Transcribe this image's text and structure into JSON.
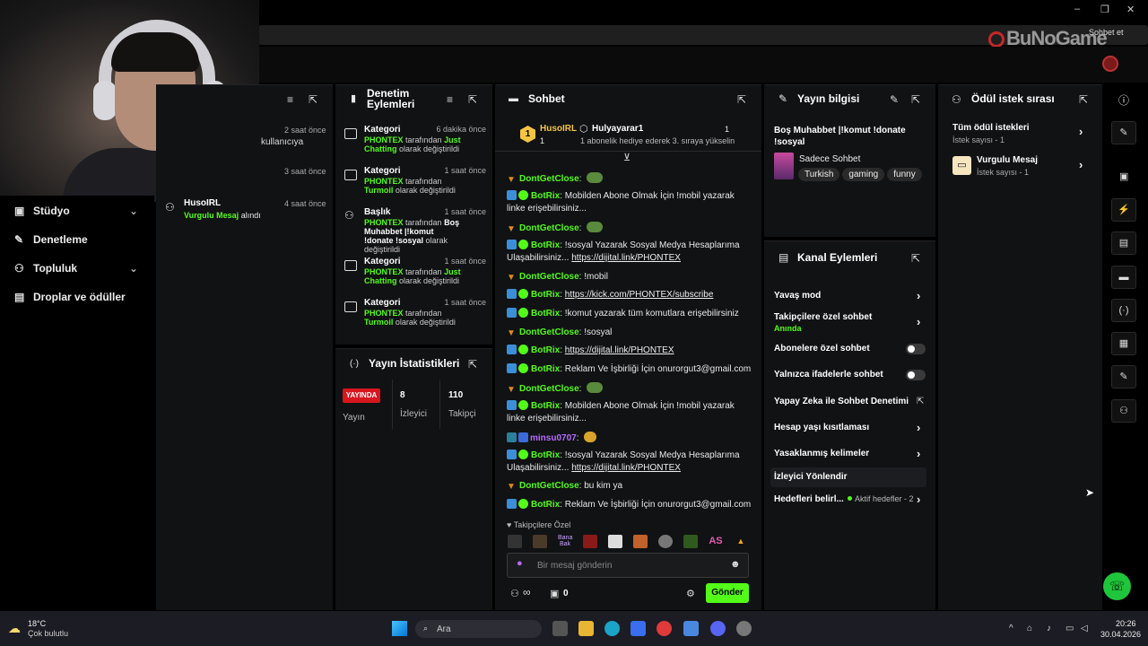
{
  "browser": {
    "tab_label": "Sohbet et",
    "logo_text": "BuNoGame",
    "win_controls": [
      "–",
      "❐",
      "✕"
    ]
  },
  "nav": {
    "studio": "Stüdyo",
    "moderation": "Denetleme",
    "community": "Topluluk",
    "drops": "Droplar ve ödüller"
  },
  "activity": {
    "rows": [
      {
        "user": "",
        "action": "kullanıcıya",
        "time": "2 saat önce"
      },
      {
        "user": "",
        "action": "",
        "time": "3 saat önce"
      },
      {
        "user": "HusoIRL",
        "highlight": "Vurgulu Mesaj",
        "action": "alındı",
        "time": "4 saat önce"
      }
    ]
  },
  "mod_actions": {
    "title_line1": "Denetim",
    "title_line2": "Eylemleri",
    "items": [
      {
        "type": "Kategori",
        "time": "6 dakika önce",
        "actor": "PHONTEX",
        "mid": "tarafından",
        "value": "Just Chatting",
        "suffix": "olarak değiştirildi"
      },
      {
        "type": "Kategori",
        "time": "1 saat önce",
        "actor": "PHONTEX",
        "mid": "tarafından",
        "value": "Turmoil",
        "suffix": "olarak değiştirildi"
      },
      {
        "type": "Başlık",
        "time": "1 saat önce",
        "actor": "PHONTEX",
        "mid": "tarafından",
        "value": "Boş Muhabbet |!komut !donate !sosyal",
        "suffix": "olarak değiştirildi"
      },
      {
        "type": "Kategori",
        "time": "1 saat önce",
        "actor": "PHONTEX",
        "mid": "tarafından",
        "value": "Just Chatting",
        "suffix": "olarak değiştirildi"
      },
      {
        "type": "Kategori",
        "time": "1 saat önce",
        "actor": "PHONTEX",
        "mid": "tarafından",
        "value": "Turmoil",
        "suffix": "olarak değiştirildi"
      }
    ]
  },
  "stats": {
    "title": "Yayın İstatistikleri",
    "live_badge": "YAYINDA",
    "live_label": "Yayın",
    "viewers_value": "8",
    "viewers_label": "İzleyici",
    "followers_value": "110",
    "followers_label": "Takipçi"
  },
  "chat": {
    "title": "Sohbet",
    "pinned_user": "HusoIRL",
    "pinned_rank": "1",
    "pinned_count": "1",
    "gift_user": "Hulyayarar1",
    "gift_count": "1",
    "gift_text": "1 abonelik hediye ederek 3. sıraya yükselin",
    "messages": [
      {
        "user": "DontGetClose",
        "text": "",
        "kind": "frog"
      },
      {
        "user": "BotRix",
        "text": "Mobilden Abone Olmak İçin !mobil yazarak linke erişebilirsiniz...",
        "kind": "bot"
      },
      {
        "user": "DontGetClose",
        "text": "",
        "kind": "frog"
      },
      {
        "user": "BotRix",
        "text": "!sosyal Yazarak Sosyal Medya Hesaplarıma Ulaşabilirsiniz...",
        "link": "https://dijital.link/PHONTEX",
        "kind": "bot"
      },
      {
        "user": "DontGetClose",
        "text": "!mobil",
        "kind": "user"
      },
      {
        "user": "BotRix",
        "link": "https://kick.com/PHONTEX/subscribe",
        "kind": "bot"
      },
      {
        "user": "BotRix",
        "text": "!komut yazarak tüm komutlara erişebilirsiniz",
        "kind": "bot"
      },
      {
        "user": "DontGetClose",
        "text": "!sosyal",
        "kind": "user"
      },
      {
        "user": "BotRix",
        "link": "https://dijital.link/PHONTEX",
        "kind": "bot"
      },
      {
        "user": "BotRix",
        "text": "Reklam Ve İşbirliği İçin onurorgut3@gmail.com",
        "kind": "bot"
      },
      {
        "user": "DontGetClose",
        "text": "",
        "kind": "frog"
      },
      {
        "user": "BotRix",
        "text": "Mobilden Abone Olmak İçin !mobil yazarak linke erişebilirsiniz...",
        "kind": "bot"
      },
      {
        "user": "minsu0707",
        "text": "",
        "kind": "purple"
      },
      {
        "user": "BotRix",
        "text": "!sosyal Yazarak Sosyal Medya Hesaplarıma Ulaşabilirsiniz...",
        "link": "https://dijital.link/PHONTEX",
        "kind": "bot"
      },
      {
        "user": "DontGetClose",
        "text": "bu kim ya",
        "kind": "user"
      },
      {
        "user": "BotRix",
        "text": "Reklam Ve İşbirliği İçin onurorgut3@gmail.com",
        "kind": "bot"
      }
    ],
    "followers_only": "Takipçilere Özel",
    "emote_labels": [
      "Bana Bak",
      "AS"
    ],
    "input_placeholder": "Bir mesaj gönderin",
    "points": "∞",
    "shop_count": "0",
    "send_label": "Gönder"
  },
  "stream_info": {
    "title": "Yayın bilgisi",
    "stream_title": "Boş Muhabbet |!komut !donate !sosyal",
    "category": "Sadece Sohbet",
    "tags": [
      "Turkish",
      "gaming",
      "funny"
    ]
  },
  "channel_actions": {
    "title": "Kanal Eylemleri",
    "slow_mode": "Yavaş mod",
    "followers_chat": "Takipçilere özel sohbet",
    "followers_chat_sub": "Anında",
    "subs_chat": "Abonelere özel sohbet",
    "emote_chat": "Yalnızca ifadelerle sohbet",
    "ai_mod": "Yapay Zeka ile Sohbet Denetimi",
    "age_limit": "Hesap yaşı kısıtlaması",
    "banned_words": "Yasaklanmış kelimeler",
    "raid": "İzleyici Yönlendir",
    "goals": "Hedefleri belirl...",
    "goals_status": "Aktif hedefler - 2"
  },
  "rewards": {
    "title": "Ödül istek sırası",
    "all_title": "Tüm ödül istekleri",
    "all_count": "İstek sayısı - 1",
    "hl_title": "Vurgulu Mesaj",
    "hl_count": "İstek sayısı - 1"
  },
  "taskbar": {
    "temp": "18°C",
    "weather": "Çok bulutlu",
    "search": "Ara",
    "time": "20:26",
    "date": "30.04.2026"
  },
  "colors": {
    "accent": "#53fc18",
    "live": "#d7161e",
    "panel": "#111214"
  }
}
